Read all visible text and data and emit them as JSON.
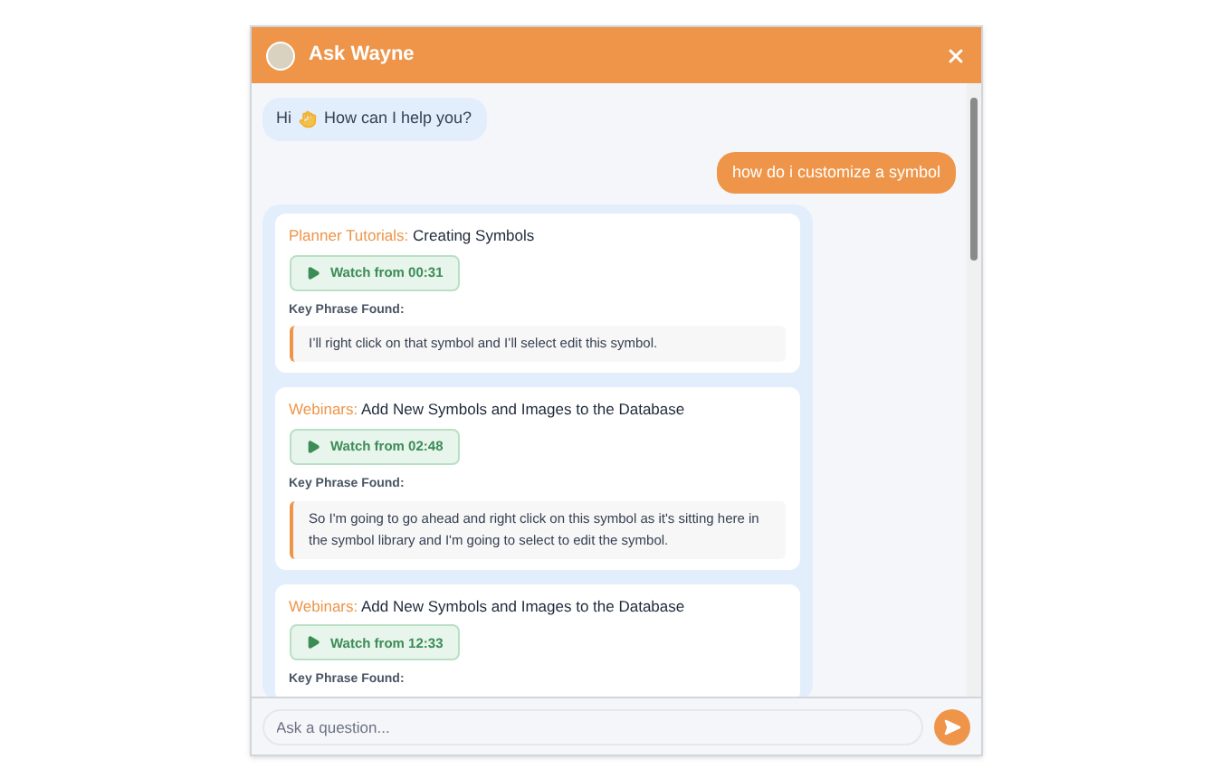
{
  "header": {
    "title": "Ask Wayne"
  },
  "messages": [
    {
      "kind": "bot",
      "before": "Hi",
      "after": "How can I help you?"
    },
    {
      "kind": "user",
      "text": "how do i customize a symbol"
    }
  ],
  "results": [
    {
      "source": "Planner Tutorials:",
      "title": "Creating Symbols",
      "watch": "Watch from 00:31",
      "phrase_label": "Key Phrase Found:",
      "phrase": "I’ll right click on that symbol and I’ll select edit this symbol."
    },
    {
      "source": "Webinars:",
      "title": "Add New Symbols and Images to the Database",
      "watch": "Watch from 02:48",
      "phrase_label": "Key Phrase Found:",
      "phrase": "So I'm going to go ahead and right click on this symbol as it's sitting here in the symbol library and I'm going to select to edit the symbol."
    },
    {
      "source": "Webinars:",
      "title": "Add New Symbols and Images to the Database",
      "watch": "Watch from 12:33",
      "phrase_label": "Key Phrase Found:"
    }
  ],
  "input": {
    "placeholder": "Ask a question..."
  }
}
